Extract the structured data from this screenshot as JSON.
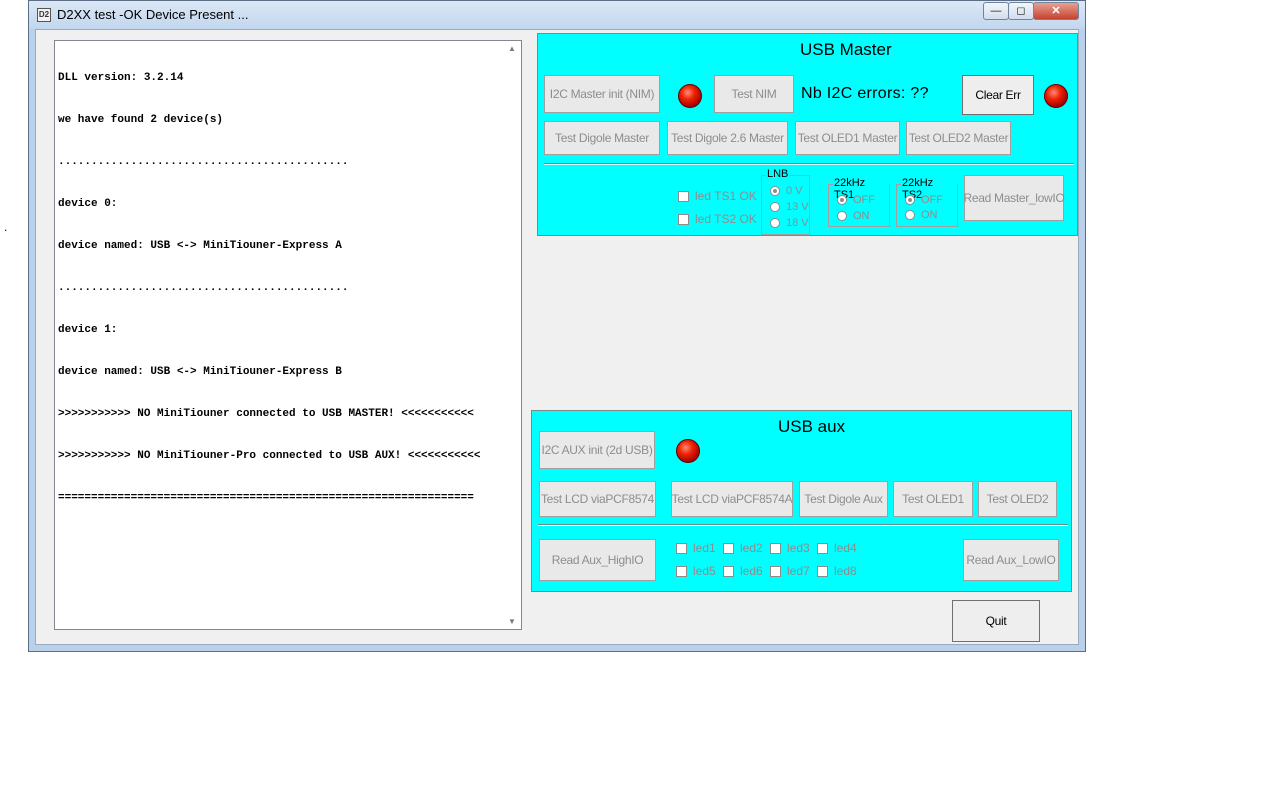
{
  "window": {
    "title": "D2XX test -OK Device Present ...",
    "icon_name": "app-icon",
    "stray_mark": "."
  },
  "log": {
    "lines": [
      "DLL version: 3.2.14",
      "we have found 2 device(s)",
      "............................................",
      "device 0:",
      "device named: USB <-> MiniTiouner-Express A",
      "............................................",
      "device 1:",
      "device named: USB <-> MiniTiouner-Express B",
      ">>>>>>>>>>> NO MiniTiouner connected to USB MASTER! <<<<<<<<<<<",
      ">>>>>>>>>>> NO MiniTiouner-Pro connected to USB AUX! <<<<<<<<<<<",
      "==============================================================="
    ]
  },
  "master": {
    "title": "USB Master",
    "i2c_init": "I2C Master init (NIM)",
    "test_nim": "Test NIM",
    "nb_errors_label": "Nb I2C errors:  ??",
    "clear_err": "Clear Err",
    "test_digole": "Test Digole Master",
    "test_digole26": "Test Digole 2.6 Master",
    "test_oled1": "Test OLED1 Master",
    "test_oled2": "Test OLED2 Master",
    "led_ts1": "led TS1 OK",
    "led_ts2": "led TS2 OK",
    "lnb": {
      "title": "LNB",
      "options": [
        "0 V",
        "13 V",
        "18 V"
      ],
      "selected": "0 V"
    },
    "ts1": {
      "title": "22kHz TS1",
      "options": [
        "OFF",
        "ON"
      ],
      "selected": "OFF"
    },
    "ts2": {
      "title": "22kHz TS2",
      "options": [
        "OFF",
        "ON"
      ],
      "selected": "OFF"
    },
    "read_low": "Read Master_lowIO",
    "led_color": "#ee2200"
  },
  "aux": {
    "title": "USB aux",
    "i2c_init": "I2C AUX init (2d USB)",
    "test_lcd1": "Test LCD  viaPCF8574",
    "test_lcd2": "Test LCD  viaPCF8574A",
    "test_digole": "Test Digole Aux",
    "test_oled1": "Test OLED1",
    "test_oled2": "Test OLED2",
    "read_high": "Read Aux_HighIO",
    "read_low": "Read Aux_LowIO",
    "leds": [
      "led1",
      "led2",
      "led3",
      "led4",
      "led5",
      "led6",
      "led7",
      "led8"
    ]
  },
  "quit": "Quit",
  "panel_color": "#00ffff"
}
